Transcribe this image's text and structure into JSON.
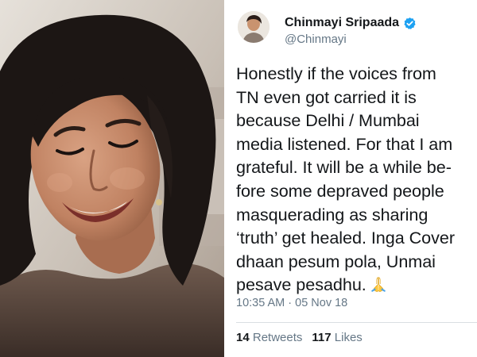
{
  "photo": {
    "subject": "smiling woman portrait",
    "colors": {
      "hair": "#1c1614",
      "skin": "#c48a6a",
      "background": "#d2cbc2"
    }
  },
  "tweet": {
    "author": {
      "display_name": "Chinmayi Sripaada",
      "handle": "@Chinmayi",
      "verified": true
    },
    "body_lines": [
      "Honestly if the voices from",
      "TN even got carried it is",
      "because Delhi / Mumbai",
      "media listened. For that I am",
      "grateful. It will be a while be-",
      "fore some depraved people",
      "masquerading as sharing",
      "‘truth’ get healed. Inga Cover",
      "dhaan pesum pola, Unmai",
      "pesave pesadhu."
    ],
    "emoji": "folded-hands-icon",
    "timestamp": "10:35 AM · 05 Nov 18",
    "stats": {
      "retweets_count": "14",
      "retweets_label": "Retweets",
      "likes_count": "117",
      "likes_label": "Likes"
    },
    "colors": {
      "text": "#14171a",
      "secondary": "#657786",
      "verified_badge": "#1da1f2",
      "divider": "#d9dee2"
    }
  }
}
